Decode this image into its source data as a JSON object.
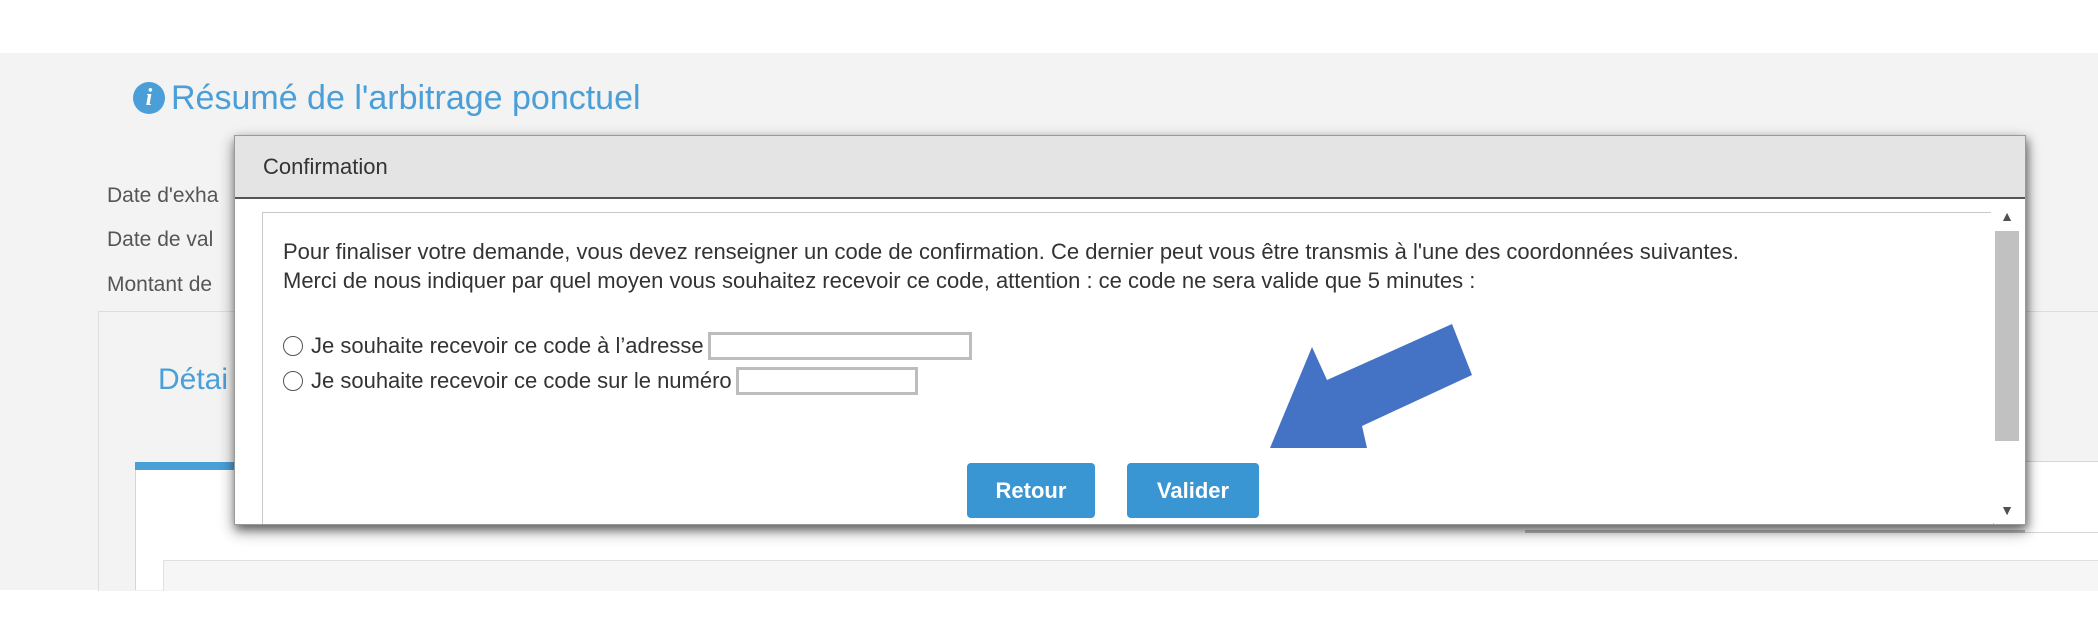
{
  "background": {
    "summary_title": "Résumé de l'arbitrage ponctuel",
    "fields": [
      {
        "label": "Date d'exha"
      },
      {
        "label": "Date de val"
      },
      {
        "label": "Montant de"
      }
    ],
    "details_title": "Détai"
  },
  "modal": {
    "title": "Confirmation",
    "line1": "Pour finaliser votre demande, vous devez renseigner un code de confirmation. Ce dernier peut vous être transmis à l'une des coordonnées suivantes.",
    "line2": "Merci de nous indiquer par quel moyen vous souhaitez recevoir ce code, attention : ce code ne sera valide que 5 minutes :",
    "options": [
      {
        "label": "Je souhaite recevoir ce code à l’adresse",
        "value": "",
        "selected": false
      },
      {
        "label": "Je souhaite recevoir ce code sur le numéro",
        "value": "",
        "selected": false
      }
    ],
    "buttons": {
      "back": "Retour",
      "validate": "Valider"
    }
  },
  "colors": {
    "accent": "#4a9fd8",
    "button": "#3a95d3",
    "annotation_arrow": "#4472c4"
  },
  "icons": {
    "title_icon": "info-icon",
    "scroll_up": "scroll-up-arrow-icon",
    "scroll_down": "scroll-down-arrow-icon",
    "annotation": "pointer-arrow-icon"
  }
}
